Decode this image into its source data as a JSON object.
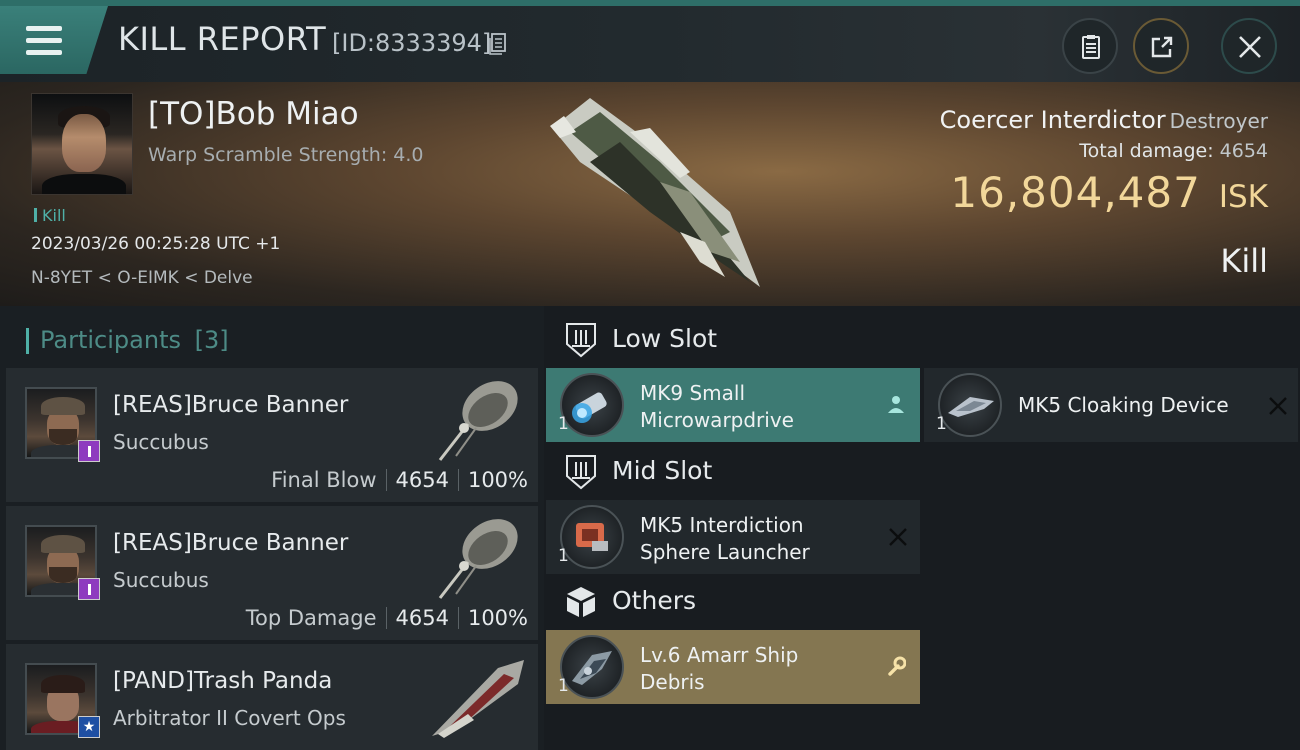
{
  "header": {
    "title": "KILL REPORT",
    "id_label": "[ID:8333394]",
    "buttons": {
      "report": "clipboard-icon",
      "share": "share-icon",
      "close": "close-icon"
    }
  },
  "victim": {
    "name": "[TO]Bob Miao",
    "warp_label": "Warp Scramble Strength: 4.0",
    "tag": "Kill",
    "timestamp": "2023/03/26 00:25:28 UTC +1",
    "location": "N-8YET < O-EIMK < Delve",
    "ship_name": "Coercer Interdictor",
    "ship_class": "Destroyer",
    "total_damage_label": "Total damage:",
    "total_damage": "4654",
    "isk_value": "16,804,487",
    "isk_unit": "ISK",
    "result": "Kill"
  },
  "participants": {
    "label": "Participants",
    "count": "[3]",
    "list": [
      {
        "name": "[REAS]Bruce Banner",
        "ship": "Succubus",
        "role": "Final Blow",
        "damage": "4654",
        "percent": "100%"
      },
      {
        "name": "[REAS]Bruce Banner",
        "ship": "Succubus",
        "role": "Top Damage",
        "damage": "4654",
        "percent": "100%"
      },
      {
        "name": "[PAND]Trash Panda",
        "ship": "Arbitrator II Covert Ops"
      }
    ]
  },
  "slots": {
    "low": {
      "label": "Low Slot",
      "items": [
        {
          "name_line1": "MK9 Small",
          "name_line2": "Microwarpdrive",
          "qty": "1",
          "state": "fitted"
        },
        {
          "name": "MK5 Cloaking Device",
          "qty": "1",
          "state": "destroyed"
        }
      ]
    },
    "mid": {
      "label": "Mid Slot",
      "items": [
        {
          "name_line1": "MK5 Interdiction",
          "name_line2": "Sphere Launcher",
          "qty": "1",
          "state": "destroyed"
        }
      ]
    },
    "others": {
      "label": "Others",
      "items": [
        {
          "name_line1": "Lv.6 Amarr Ship",
          "name_line2": "Debris",
          "qty": "1",
          "state": "dropped"
        }
      ]
    }
  },
  "colors": {
    "accent": "#4fb0a7",
    "isk": "#f2d79a",
    "active_row": "#3d7a73",
    "gold_row": "#847651"
  }
}
